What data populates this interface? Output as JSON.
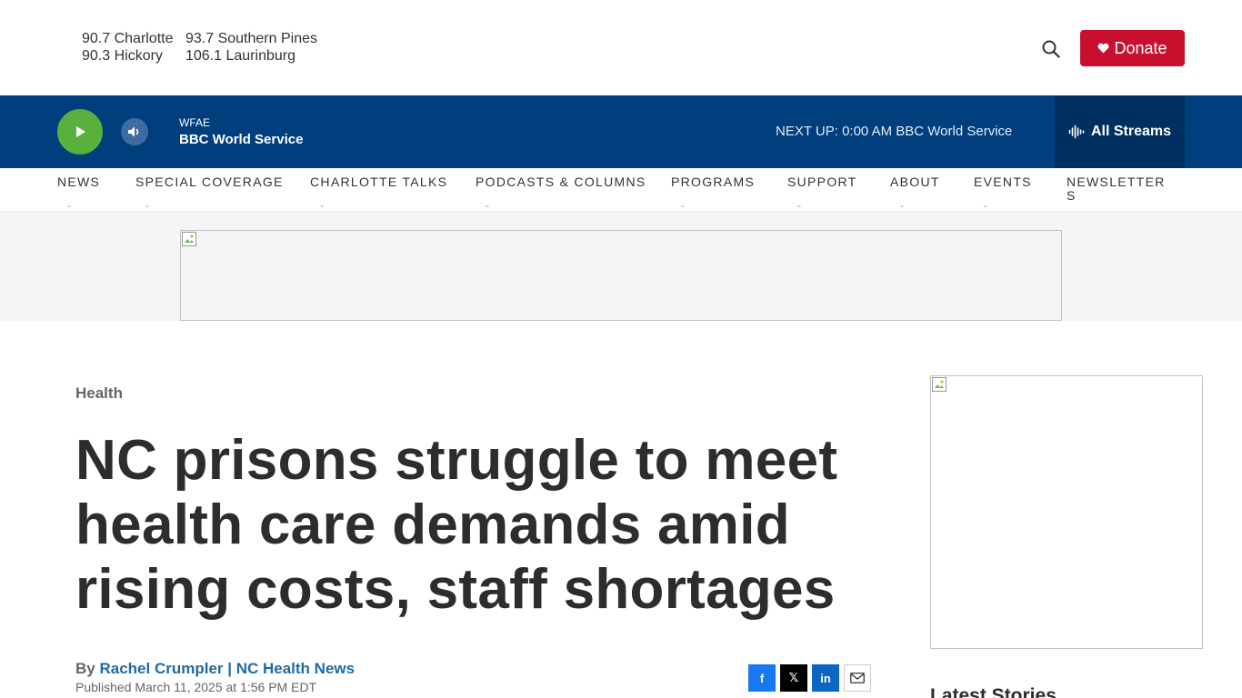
{
  "header": {
    "frequencies": [
      {
        "freq": "90.7",
        "city": "Charlotte"
      },
      {
        "freq": "93.7",
        "city": "Southern Pines"
      },
      {
        "freq": "90.3",
        "city": "Hickory"
      },
      {
        "freq": "106.1",
        "city": "Laurinburg"
      }
    ],
    "frequency_lines": [
      "90.7 Charlotte",
      "93.7 Southern Pines",
      "90.3 Hickory",
      "106.1 Laurinburg"
    ],
    "search_icon": "search-icon",
    "donate_label": "Donate",
    "donate_icon": "heart-icon",
    "donate_color": "#c8102e"
  },
  "player": {
    "station": "WFAE",
    "program": "BBC World Service",
    "next_up": "NEXT UP: 0:00 AM BBC World Service",
    "all_streams_label": "All Streams",
    "play_icon": "play-icon",
    "volume_icon": "volume-icon",
    "streams_icon": "audio-wave-icon",
    "bar_color": "#003e7e",
    "play_color": "#5ab03c"
  },
  "nav": {
    "items": [
      {
        "label": "NEWS"
      },
      {
        "label": "SPECIAL COVERAGE"
      },
      {
        "label": "CHARLOTTE TALKS"
      },
      {
        "label": "PODCASTS & COLUMNS"
      },
      {
        "label": "PROGRAMS"
      },
      {
        "label": "SUPPORT"
      },
      {
        "label": "ABOUT"
      },
      {
        "label": "EVENTS"
      },
      {
        "label": "NEWSLETTERS"
      }
    ],
    "chevron": "⌄"
  },
  "article": {
    "kicker": "Health",
    "headline": "NC prisons struggle to meet health care demands amid rising costs, staff shortages",
    "byline_prefix": "By ",
    "author": "Rachel Crumpler | NC Health News",
    "published": "Published March 11, 2025 at 1:56 PM EDT",
    "share": {
      "facebook": "f",
      "x": "𝕏",
      "linkedin": "in",
      "email_icon": "mail-icon"
    }
  },
  "sidebar": {
    "latest_title": "Latest Stories"
  }
}
